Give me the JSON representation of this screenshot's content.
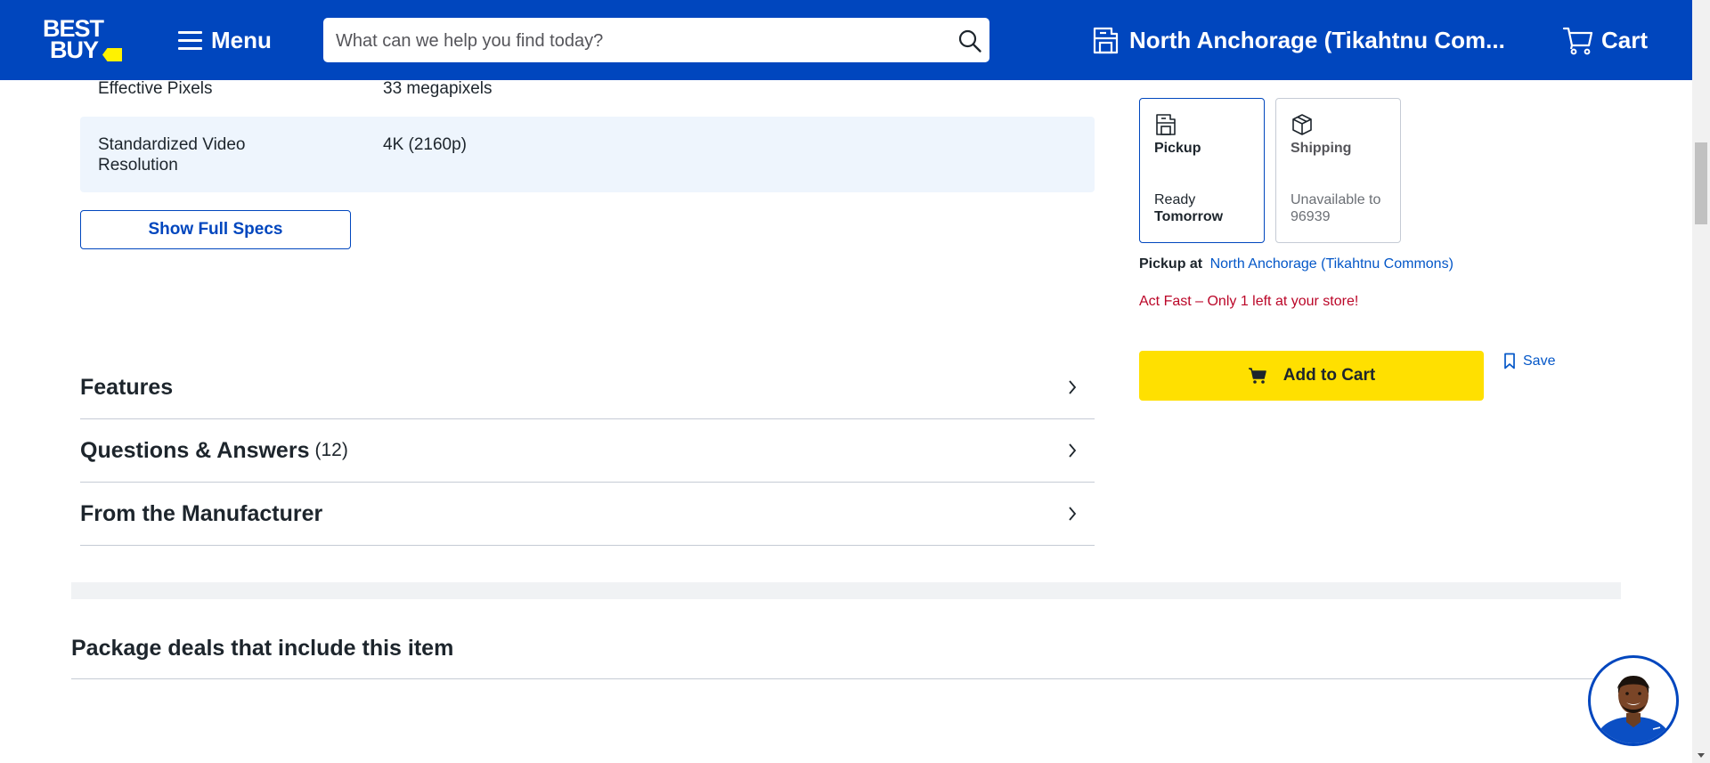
{
  "header": {
    "logo_line1": "BEST",
    "logo_line2": "BUY",
    "menu_label": "Menu",
    "search_placeholder": "What can we help you find today?",
    "store_label": "North Anchorage (Tikahtnu Com...",
    "cart_label": "Cart"
  },
  "specs": {
    "rows": [
      {
        "key": "Effective Pixels",
        "value": "33 megapixels"
      },
      {
        "key": "Standardized Video Resolution",
        "value": "4K (2160p)"
      }
    ],
    "show_full_label": "Show Full Specs"
  },
  "accordion": [
    {
      "title": "Features",
      "count": ""
    },
    {
      "title": "Questions & Answers",
      "count": "(12)"
    },
    {
      "title": "From the Manufacturer",
      "count": ""
    }
  ],
  "package": {
    "title": "Package deals that include this item"
  },
  "fulfillment": {
    "pickup": {
      "name": "Pickup",
      "line1": "Ready",
      "line2": "Tomorrow"
    },
    "shipping": {
      "name": "Shipping",
      "line1": "Unavailable to",
      "line2": "96939"
    },
    "pickup_at_label": "Pickup at",
    "pickup_store": "North Anchorage (Tikahtnu Commons)",
    "stock_alert": "Act Fast – Only 1 left at your store!",
    "add_to_cart_label": "Add to Cart",
    "save_label": "Save"
  },
  "colors": {
    "brand_blue": "#0046be",
    "brand_yellow": "#ffe000",
    "alert_red": "#bb0628",
    "link_blue": "#0457c8"
  }
}
